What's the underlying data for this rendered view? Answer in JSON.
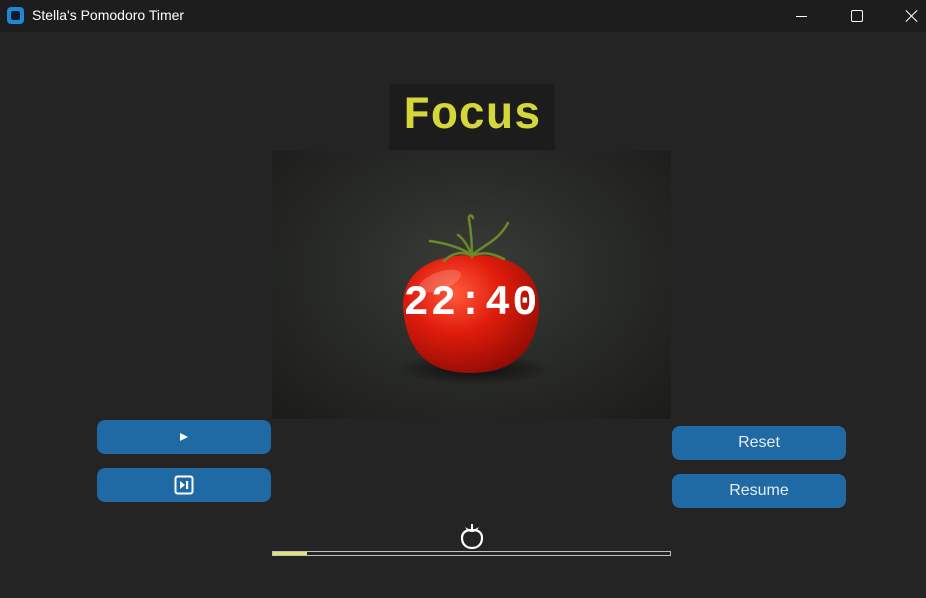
{
  "window": {
    "title": "Stella's Pomodoro Timer",
    "controls": [
      "minimize",
      "maximize",
      "close"
    ]
  },
  "timer": {
    "mode_label": "Focus",
    "time_remaining": "22:40",
    "image": "tomato-photo"
  },
  "buttons": {
    "start": {
      "icon": "play-icon"
    },
    "skip": {
      "icon": "skip-forward-icon"
    },
    "reset_label": "Reset",
    "resume_label": "Resume"
  },
  "session": {
    "counter_icon": "tomato-icon",
    "progress_fraction": 0.086
  },
  "colors": {
    "background": "#242424",
    "mode_label": "#d4d63a",
    "button": "#1f6aa5",
    "progress_fill": "#e3e07a"
  }
}
